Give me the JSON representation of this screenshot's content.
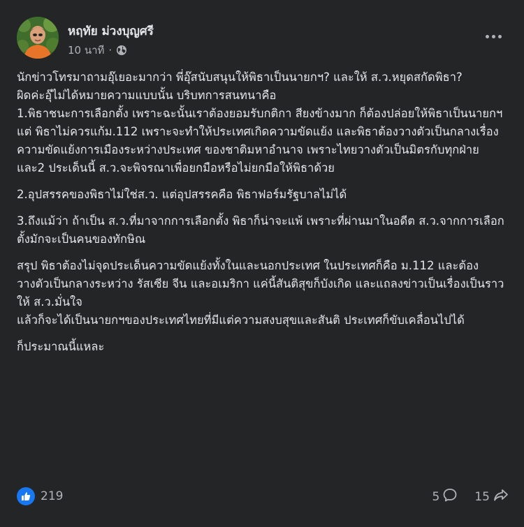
{
  "post": {
    "author": "หฤทัย ม่วงบุญศรี",
    "time": "10 นาที",
    "separator": "·",
    "privacy_icon": "globe-icon",
    "more_icon": "more-options-icon",
    "paragraphs": [
      {
        "text": "นักข่าวโทรมาถามอุ๊เยอะมากว่า พี่อุ๊สนับสนุนให้พิธาเป็นนายกฯ? และให้ ส.ว.หยุดสกัดพิธา?",
        "gap": false
      },
      {
        "text": "ผิดค่ะอุ๊ไม่ได้หมายความแบบนั้น บริบทการสนทนาคือ",
        "gap": false
      },
      {
        "text": "1.พิธาชนะการเลือกตั้ง เพราะฉะนั้นเราต้องยอมรับกติกา สียงข้างมาก ก็ต้องปล่อยให้พิธาเป็นนายกฯ",
        "gap": false
      },
      {
        "text": "แต่ พิธาไม่ควรแก้ม.112 เพราะจะทำให้ประเทศเกิดความขัดแย้ง และพิธาต้องวางตัวเป็นกลางเรื่องความขัดแย้งการเมืองระหว่างประเทศ ของชาติมหาอำนาจ เพราะไทยวางตัวเป็นมิตรกับทุกฝ่าย และ2 ประเด็นนี้ ส.ว.จะพิจรณาเพื่อยกมือหรือไม่ยกมือให้พิธาด้วย",
        "gap": false
      },
      {
        "text": "2.อุปสรรคของพิธาไม่ใช่ส.ว. แต่อุปสรรคคือ พิธาฟอร์มรัฐบาลไม่ได้",
        "gap": true
      },
      {
        "text": "3.ถึงแม้ว่า ถ้าเป็น ส.ว.ที่มาจากการเลือกตั้ง พิธาก็น่าจะแพ้ เพราะที่ผ่านมาในอดีต ส.ว.จากการเลือกตั้งมักจะเป็นคนของทักษิณ",
        "gap": true
      },
      {
        "text": "สรุป พิธาต้องไม่จุดประเด็นความขัดแย้งทั้งในและนอกประเทศ ในประเทศก็คือ ม.112 และต้องวางตัวเป็นกลางระหว่าง รัสเซีย จีน และอเมริกา แค่นี้สันติสุขก็บังเกิด และแถลงข่าวเป็นเรื่องเป็นราว ให้ ส.ว.มั่นใจ",
        "gap": true
      },
      {
        "text": "แล้วก็จะได้เป็นนายกฯของประเทศไทยที่มีแต่ความสงบสุขและสันติ ประเทศก็ขับเคลื่อนไปได้",
        "gap": false
      },
      {
        "text": "ก็ประมาณนี้แหละ",
        "gap": true
      }
    ],
    "reactions": {
      "icon": "like-icon",
      "count": "219"
    },
    "comments": {
      "count": "5",
      "icon": "comment-icon"
    },
    "shares": {
      "count": "15",
      "icon": "share-icon"
    }
  },
  "colors": {
    "background": "#242526",
    "text_primary": "#e4e6eb",
    "text_secondary": "#b0b3b8",
    "like_blue": "#1877f2"
  }
}
